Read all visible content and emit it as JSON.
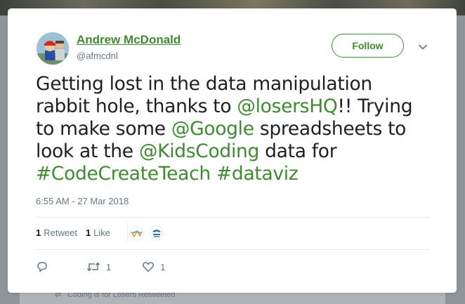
{
  "tweet": {
    "author": {
      "name": "Andrew McDonald",
      "handle": "@afmcdnl"
    },
    "follow_label": "Follow",
    "text_parts": {
      "t1": "Getting lost in the data manipulation rabbit hole, thanks to ",
      "m1": "@losersHQ",
      "t2": "!!  Trying to make some ",
      "m2": "@Google",
      "t3": " spreadsheets to look at the ",
      "m3": "@KidsCoding",
      "t4": " data for ",
      "h1": "#CodeCreateTeach",
      "t5": " ",
      "h2": "#dataviz"
    },
    "timestamp": "6:55 AM - 27 Mar 2018",
    "stats": {
      "retweet_count": "1",
      "retweet_label": "Retweet",
      "like_count": "1",
      "like_label": "Like"
    },
    "actions": {
      "retweet_count": "1",
      "like_count": "1"
    }
  },
  "background": {
    "retweeted_text": "Coding is for Losers Retweeted"
  },
  "colors": {
    "link": "#3f8b30",
    "text": "#1c2022",
    "muted": "#697882",
    "divider": "#e6ecf0"
  },
  "icons": {
    "reply": "reply-icon",
    "retweet": "retweet-icon",
    "like": "heart-icon",
    "caret": "chevron-down-icon"
  }
}
